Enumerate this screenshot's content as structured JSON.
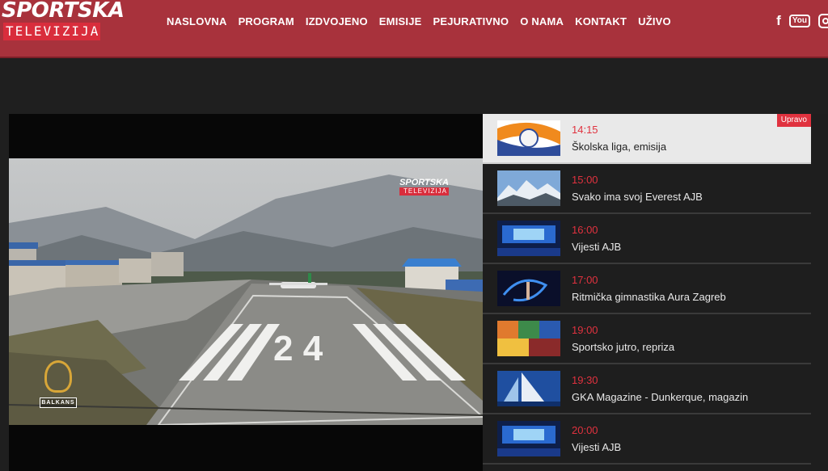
{
  "header": {
    "logo": {
      "line1": "SPORTSKA",
      "line2": "TELEVIZIJA"
    },
    "nav": [
      "NASLOVNA",
      "PROGRAM",
      "IZDVOJENO",
      "EMISIJE",
      "PEJURATIVNO",
      "O NAMA",
      "KONTAKT",
      "UŽIVO"
    ],
    "social_icons": [
      "facebook-icon",
      "youtube-icon",
      "instagram-icon"
    ],
    "social_glyphs": {
      "facebook": "f",
      "youtube": "You"
    }
  },
  "player": {
    "watermark": {
      "line1": "SPORTSKA",
      "line2": "TELEVIZIJA"
    },
    "runway_number": "2 4",
    "aljazeera_label": "BALKANS"
  },
  "schedule": {
    "live_badge": "Upravo",
    "items": [
      {
        "time": "14:15",
        "title": "Školska liga, emisija",
        "active": true,
        "thumb": "school-league"
      },
      {
        "time": "15:00",
        "title": "Svako ima svoj Everest AJB",
        "active": false,
        "thumb": "mountains"
      },
      {
        "time": "16:00",
        "title": "Vijesti AJB",
        "active": false,
        "thumb": "news-studio"
      },
      {
        "time": "17:00",
        "title": "Ritmička gimnastika Aura Zagreb",
        "active": false,
        "thumb": "gymnastics"
      },
      {
        "time": "19:00",
        "title": "Sportsko jutro, repriza",
        "active": false,
        "thumb": "sports-morning"
      },
      {
        "time": "19:30",
        "title": "GKA Magazine - Dunkerque, magazin",
        "active": false,
        "thumb": "sailing"
      },
      {
        "time": "20:00",
        "title": "Vijesti AJB",
        "active": false,
        "thumb": "news-studio"
      }
    ]
  },
  "colors": {
    "header": "#a8323c",
    "accent": "#e0323f",
    "background": "#1f1f1f"
  }
}
